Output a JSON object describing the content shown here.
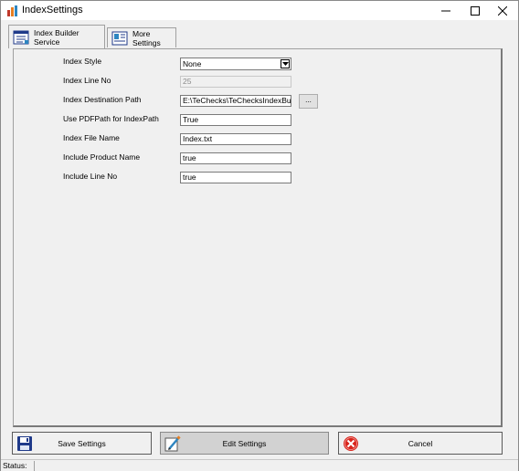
{
  "window": {
    "title": "IndexSettings",
    "minimize": "minimize",
    "maximize": "maximize",
    "close": "close"
  },
  "tabs": [
    {
      "label": "Index Builder Service",
      "icon": "list-icon",
      "active": true
    },
    {
      "label": "More Settings",
      "icon": "card-icon",
      "active": false
    }
  ],
  "form": {
    "index_style": {
      "label": "Index Style",
      "value": "None"
    },
    "index_line_no": {
      "label": "Index Line No",
      "value": "25"
    },
    "index_destination_path": {
      "label": "Index Destination Path",
      "value": "E:\\TeChecks\\TeChecksIndexBuilder\\",
      "browse_label": "..."
    },
    "use_pdfpath": {
      "label": "Use PDFPath for IndexPath",
      "value": "True"
    },
    "index_file_name": {
      "label": "Index File Name",
      "value": "Index.txt"
    },
    "include_product_name": {
      "label": "Include Product Name",
      "value": "true"
    },
    "include_line_no": {
      "label": "Include Line No",
      "value": "true"
    }
  },
  "buttons": {
    "save": "Save Settings",
    "edit": "Edit Settings",
    "cancel": "Cancel"
  },
  "status": {
    "label": "Status:"
  },
  "colors": {
    "cancel_red": "#d9251c",
    "save_blue": "#1f3a8a"
  }
}
